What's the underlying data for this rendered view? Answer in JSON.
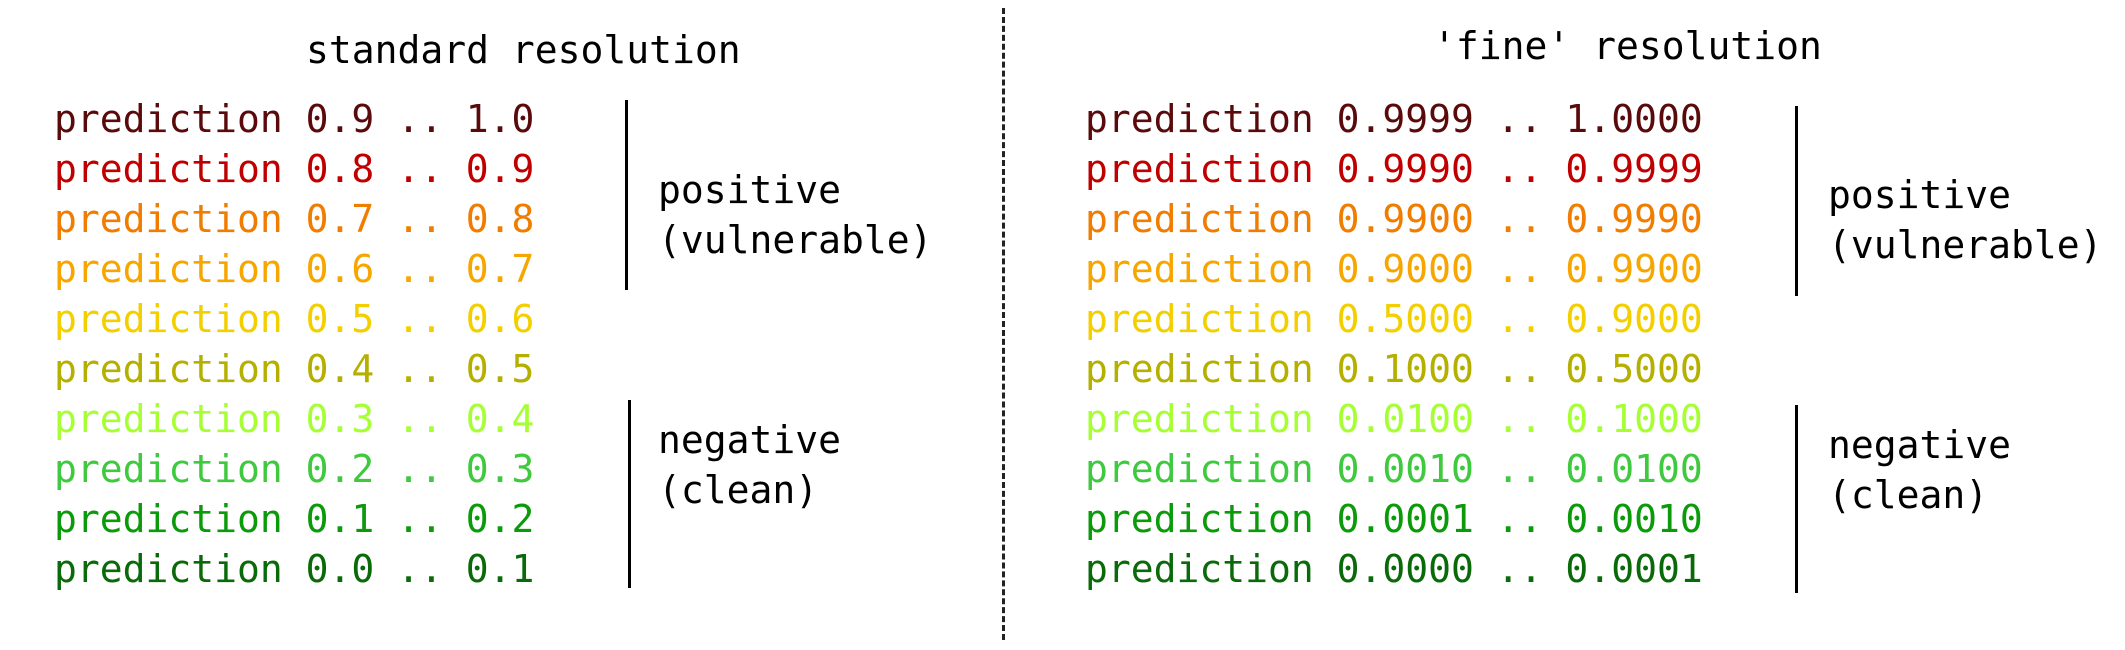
{
  "left": {
    "title": "standard resolution",
    "rows": [
      {
        "text": "prediction 0.9 .. 1.0",
        "color": "#5a0a0a"
      },
      {
        "text": "prediction 0.8 .. 0.9",
        "color": "#c00000"
      },
      {
        "text": "prediction 0.7 .. 0.8",
        "color": "#f07c00"
      },
      {
        "text": "prediction 0.6 .. 0.7",
        "color": "#f7a600"
      },
      {
        "text": "prediction 0.5 .. 0.6",
        "color": "#f4cf00"
      },
      {
        "text": "prediction 0.4 .. 0.5",
        "color": "#b5b000"
      },
      {
        "text": "prediction 0.3 .. 0.4",
        "color": "#a6ff33"
      },
      {
        "text": "prediction 0.2 .. 0.3",
        "color": "#3ec93e"
      },
      {
        "text": "prediction 0.1 .. 0.2",
        "color": "#0a9a0a"
      },
      {
        "text": "prediction 0.0 .. 0.1",
        "color": "#0a6a0a"
      }
    ],
    "positive_label_1": "positive",
    "positive_label_2": "(vulnerable)",
    "negative_label_1": "negative",
    "negative_label_2": "(clean)"
  },
  "right": {
    "title": "'fine' resolution",
    "rows": [
      {
        "text": "prediction 0.9999 .. 1.0000",
        "color": "#5a0a0a"
      },
      {
        "text": "prediction 0.9990 .. 0.9999",
        "color": "#c00000"
      },
      {
        "text": "prediction 0.9900 .. 0.9990",
        "color": "#f07c00"
      },
      {
        "text": "prediction 0.9000 .. 0.9900",
        "color": "#f7a600"
      },
      {
        "text": "prediction 0.5000 .. 0.9000",
        "color": "#f4cf00"
      },
      {
        "text": "prediction 0.1000 .. 0.5000",
        "color": "#b5b000"
      },
      {
        "text": "prediction 0.0100 .. 0.1000",
        "color": "#a6ff33"
      },
      {
        "text": "prediction 0.0010 .. 0.0100",
        "color": "#3ec93e"
      },
      {
        "text": "prediction 0.0001 .. 0.0010",
        "color": "#0a9a0a"
      },
      {
        "text": "prediction 0.0000 .. 0.0001",
        "color": "#0a6a0a"
      }
    ],
    "positive_label_1": "positive",
    "positive_label_2": "(vulnerable)",
    "negative_label_1": "negative",
    "negative_label_2": "(clean)"
  }
}
